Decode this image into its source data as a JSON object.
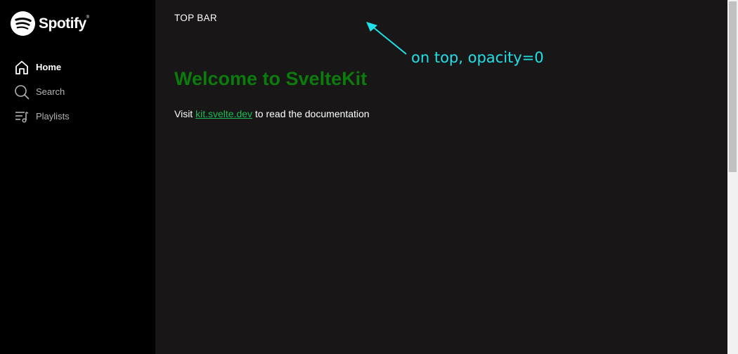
{
  "app": {
    "brand": "Spotify"
  },
  "sidebar": {
    "items": [
      {
        "label": "Home",
        "icon": "home-icon",
        "active": true
      },
      {
        "label": "Search",
        "icon": "search-icon",
        "active": false
      },
      {
        "label": "Playlists",
        "icon": "playlist-icon",
        "active": false
      }
    ]
  },
  "main": {
    "topbar_label": "TOP BAR",
    "headline": "Welcome to SvelteKit",
    "paragraph_before": "Visit ",
    "link_text": "kit.svelte.dev",
    "paragraph_after": " to read the documentation"
  },
  "annotation": {
    "text": "on top, opacity=0"
  },
  "colors": {
    "sidebar_bg": "#000000",
    "main_bg": "#181616",
    "headline": "#0c7a0c",
    "link": "#1db954",
    "annotation": "#22e0e8"
  }
}
